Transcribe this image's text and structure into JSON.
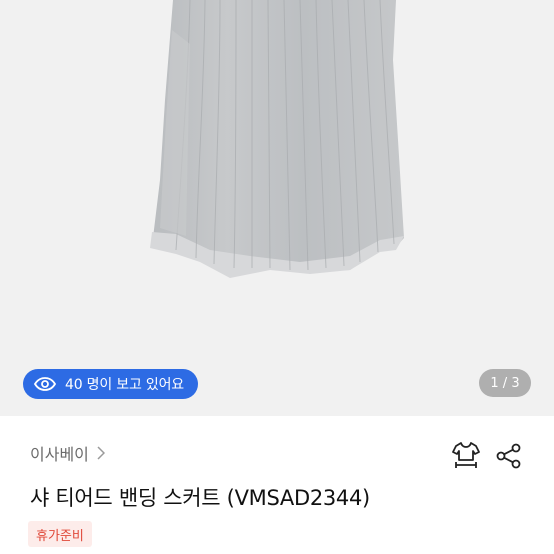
{
  "hero": {
    "viewers_text": "40 명이 보고 있어요",
    "page_counter": "1 / 3"
  },
  "product": {
    "store_name": "이사베이",
    "title": "샤 티어드 밴딩 스커트 (VMSAD2344)",
    "tag": "휴가준비"
  },
  "icons": {
    "viewers": "eye-icon",
    "store_arrow": "chevron-right-icon",
    "fit": "shirt-size-icon",
    "share": "share-icon"
  },
  "colors": {
    "accent": "#2d6be4",
    "tag_text": "#e0493a",
    "tag_bg": "#fdecea"
  }
}
